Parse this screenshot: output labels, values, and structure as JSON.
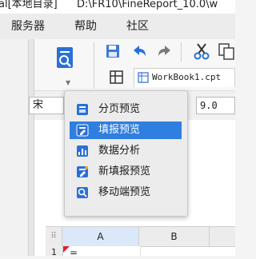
{
  "window": {
    "title_left": "al[本地目录]",
    "title_path": "D:\\FR10\\FineReport_10.0\\w"
  },
  "menubar": {
    "items": [
      "服务器",
      "帮助",
      "社区"
    ]
  },
  "toolbar": {
    "workbook_tab": "WorkBook1.cpt"
  },
  "properties": {
    "font_name": "宋",
    "font_size": "9.0"
  },
  "popup_menu": {
    "items": [
      {
        "label": "分页预览",
        "icon": "page-preview-icon",
        "selected": false
      },
      {
        "label": "填报预览",
        "icon": "fill-preview-icon",
        "selected": true
      },
      {
        "label": "数据分析",
        "icon": "data-analysis-icon",
        "selected": false
      },
      {
        "label": "新填报预览",
        "icon": "new-fill-preview-icon",
        "selected": false
      },
      {
        "label": "移动端预览",
        "icon": "mobile-preview-icon",
        "selected": false
      }
    ]
  },
  "grid": {
    "columns": [
      "A",
      "B"
    ],
    "rows": [
      {
        "number": "1",
        "cells": [
          "=",
          ""
        ]
      }
    ]
  },
  "colors": {
    "accent": "#2f7fe0",
    "icon_blue": "#2a6fd6",
    "cell_marker": "#e0202a"
  }
}
